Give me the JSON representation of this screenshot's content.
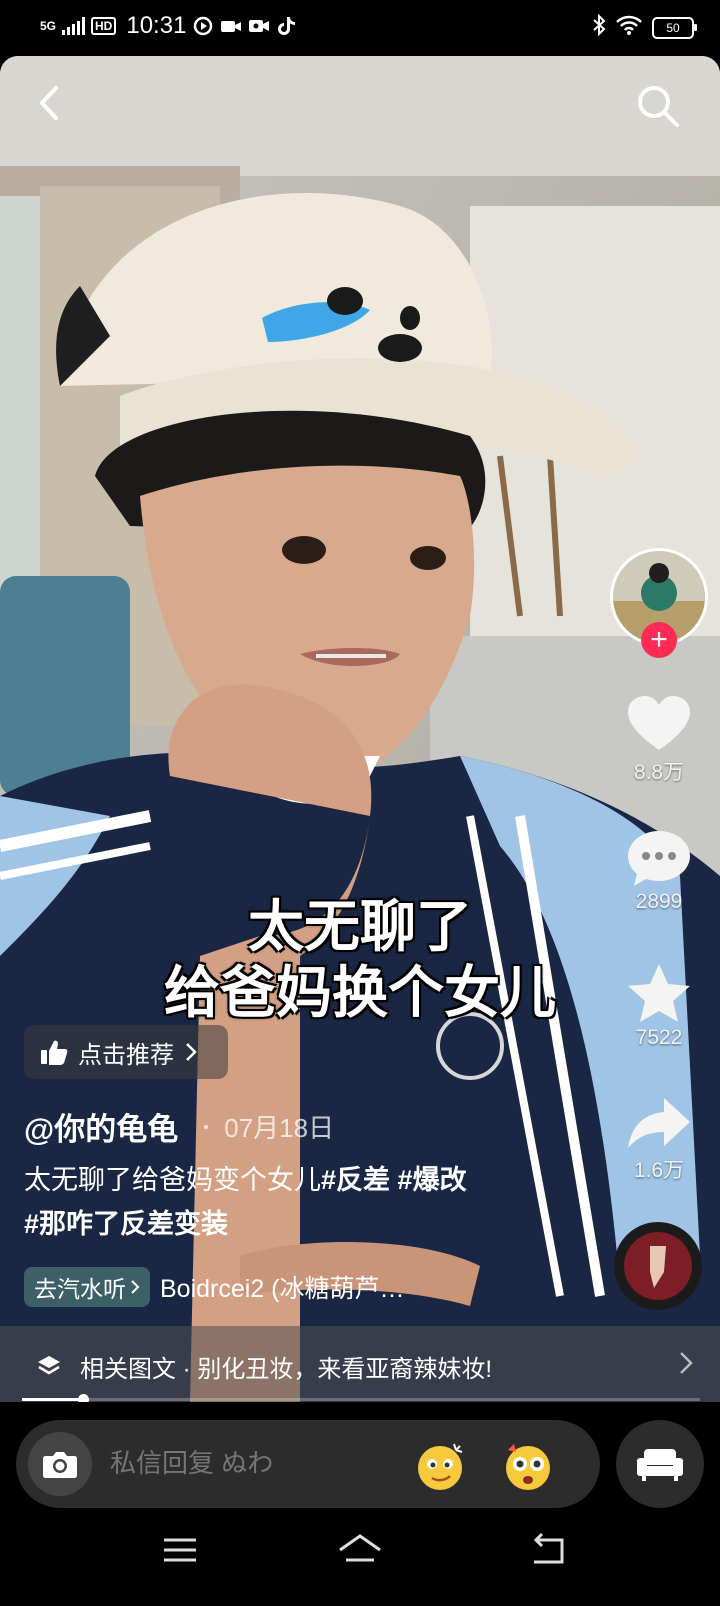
{
  "status_bar": {
    "network": "5G",
    "hd": "HD",
    "time": "10:31",
    "battery": "50",
    "icons": [
      "signal-icon",
      "video-app-icon",
      "camera-icon",
      "screen-record-icon",
      "tiktok-icon",
      "bluetooth-icon",
      "wifi-icon",
      "battery-icon"
    ]
  },
  "nav": {
    "back_icon": "chevron-left-icon",
    "search_icon": "search-icon"
  },
  "caption": {
    "line1": "太无聊了",
    "line2": "给爸妈换个女儿"
  },
  "actions": {
    "likes": "8.8万",
    "comments": "2899",
    "favorites": "7522",
    "shares": "1.6万"
  },
  "video_info": {
    "recommend_label": "点击推荐",
    "author": "@你的龟龟",
    "date": "07月18日",
    "desc_text": "太无聊了给爸妈变个女儿",
    "tags": [
      "#反差",
      "#爆改",
      "#那咋了反差变装"
    ],
    "music_chip": "去汽水听",
    "music_title": "Boidrcei2 (冰糖葫芦…"
  },
  "related": {
    "label": "相关图文",
    "text": "别化丑妆，来看亚裔辣妹妆!"
  },
  "progress": {
    "fraction": 0.09
  },
  "reply": {
    "placeholder": "私信回复 ぬわ"
  },
  "colors": {
    "accent": "#fe2c55",
    "background": "#000000"
  }
}
